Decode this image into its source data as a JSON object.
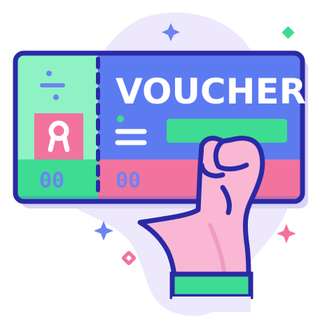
{
  "illustration": {
    "title": "VOUCHER",
    "stub_code": "00",
    "main_code": "00",
    "colors": {
      "outline": "#2a2aa6",
      "ticket_blue": "#5d7bf0",
      "ticket_shadow": "#4a63d9",
      "stub_mint": "#8ef2c4",
      "band_pink": "#f2739e",
      "band_green": "#3ddc92",
      "blob": "#ede8fb",
      "hand": "#f9b7d4",
      "hand_shadow": "#ef9cc1",
      "sleeve": "#3ddc92",
      "sparkle_blue": "#6d83f2",
      "sparkle_green": "#3ddc92",
      "sparkle_pink": "#f2739e"
    },
    "icons": [
      "sparkle-icon",
      "diamond-icon",
      "ribbon-badge-icon",
      "minus-divide-icon",
      "equals-icon",
      "hand-icon"
    ]
  }
}
